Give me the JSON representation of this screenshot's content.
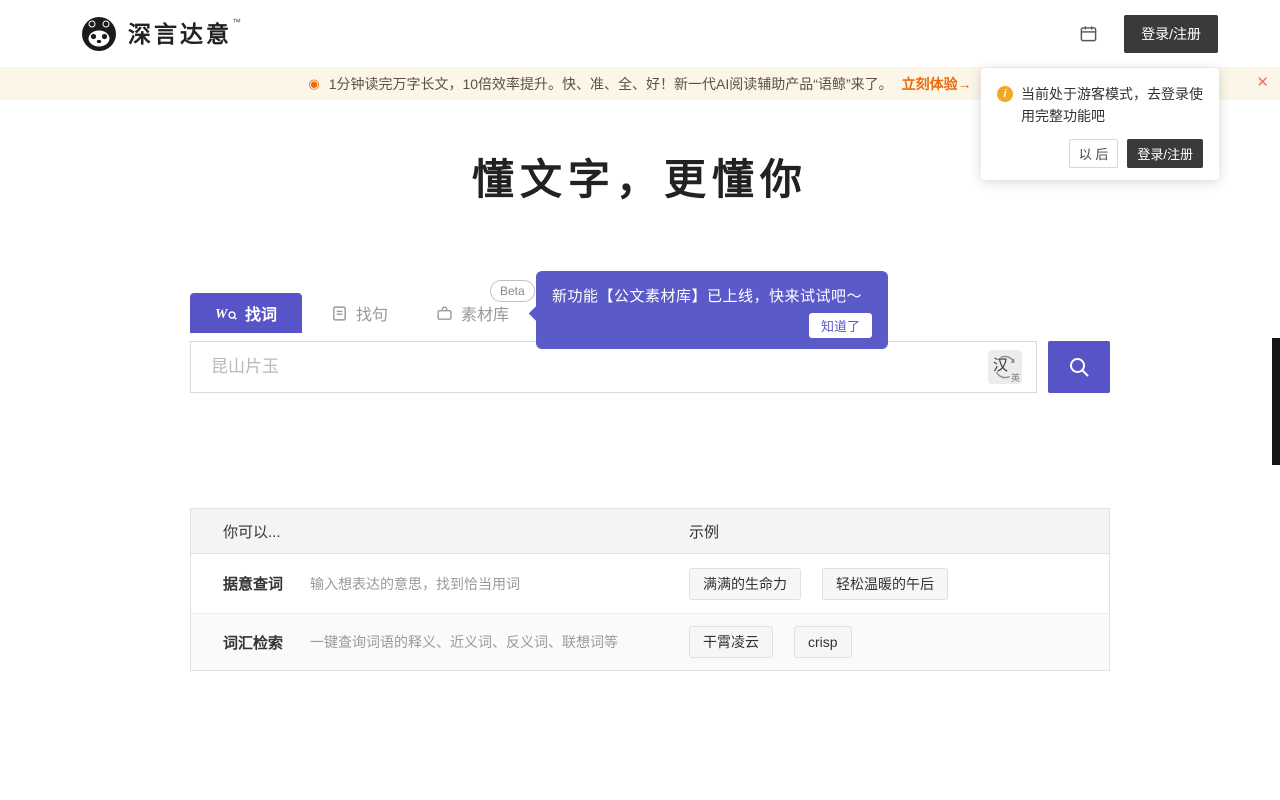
{
  "header": {
    "brand": "深言达意",
    "trademark": "™",
    "login_button": "登录/注册"
  },
  "banner": {
    "dot_icon": "◉",
    "text": "1分钟读完万字长文，10倍效率提升。快、准、全、好！新一代AI阅读辅助产品“语鲸”来了。",
    "cta": "立刻体验→",
    "close_icon": "✕"
  },
  "guest_popup": {
    "icon_char": "i",
    "text": "当前处于游客模式，去登录使用完整功能吧",
    "later_button": "以 后",
    "login_button": "登录/注册"
  },
  "hero": {
    "title": "懂文字，更懂你"
  },
  "tabs": [
    {
      "label": "找词",
      "active": true
    },
    {
      "label": "找句",
      "active": false
    },
    {
      "label": "素材库",
      "active": false,
      "badge": "Beta"
    }
  ],
  "feature_tooltip": {
    "text": "新功能【公文素材库】已上线，快来试试吧～",
    "confirm_button": "知道了"
  },
  "search": {
    "placeholder": "昆山片玉",
    "lang_primary": "汉",
    "lang_secondary": "英"
  },
  "table": {
    "headers": [
      "你可以...",
      "示例"
    ],
    "rows": [
      {
        "name": "据意查词",
        "desc": "输入想表达的意思，找到恰当用词",
        "examples": [
          "满满的生命力",
          "轻松温暖的午后"
        ]
      },
      {
        "name": "词汇检索",
        "desc": "一键查询词语的释义、近义词、反义词、联想词等",
        "examples": [
          "干霄凌云",
          "crisp"
        ]
      }
    ]
  },
  "colors": {
    "accent": "#5654c6",
    "tooltip_bg": "#5b5ac9",
    "banner_bg": "#fcf6e8",
    "banner_accent": "#ed6a0c",
    "dark_button": "#3a3a3a"
  }
}
